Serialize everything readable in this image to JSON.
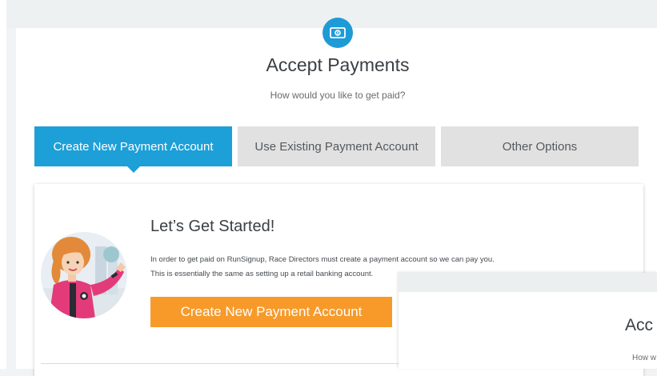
{
  "header": {
    "title": "Accept Payments",
    "subtitle": "How would you like to get paid?",
    "badge_icon": "money-icon"
  },
  "tabs": [
    {
      "label": "Create New Payment Account",
      "active": true
    },
    {
      "label": "Use Existing Payment Account",
      "active": false
    },
    {
      "label": "Other Options",
      "active": false
    }
  ],
  "content": {
    "title": "Let’s Get Started!",
    "lines": [
      "In order to get paid on RunSignup, Race Directors must create a payment account so we can pay you.",
      "This is essentially the same as setting up a retail banking account."
    ],
    "button_label": "Create New Payment Account"
  },
  "overlay": {
    "title": "Acc",
    "subtitle": "How w"
  },
  "colors": {
    "accent": "#1d9fd8",
    "button": "#f79a2a",
    "tab_inactive": "#e1e1e1"
  }
}
